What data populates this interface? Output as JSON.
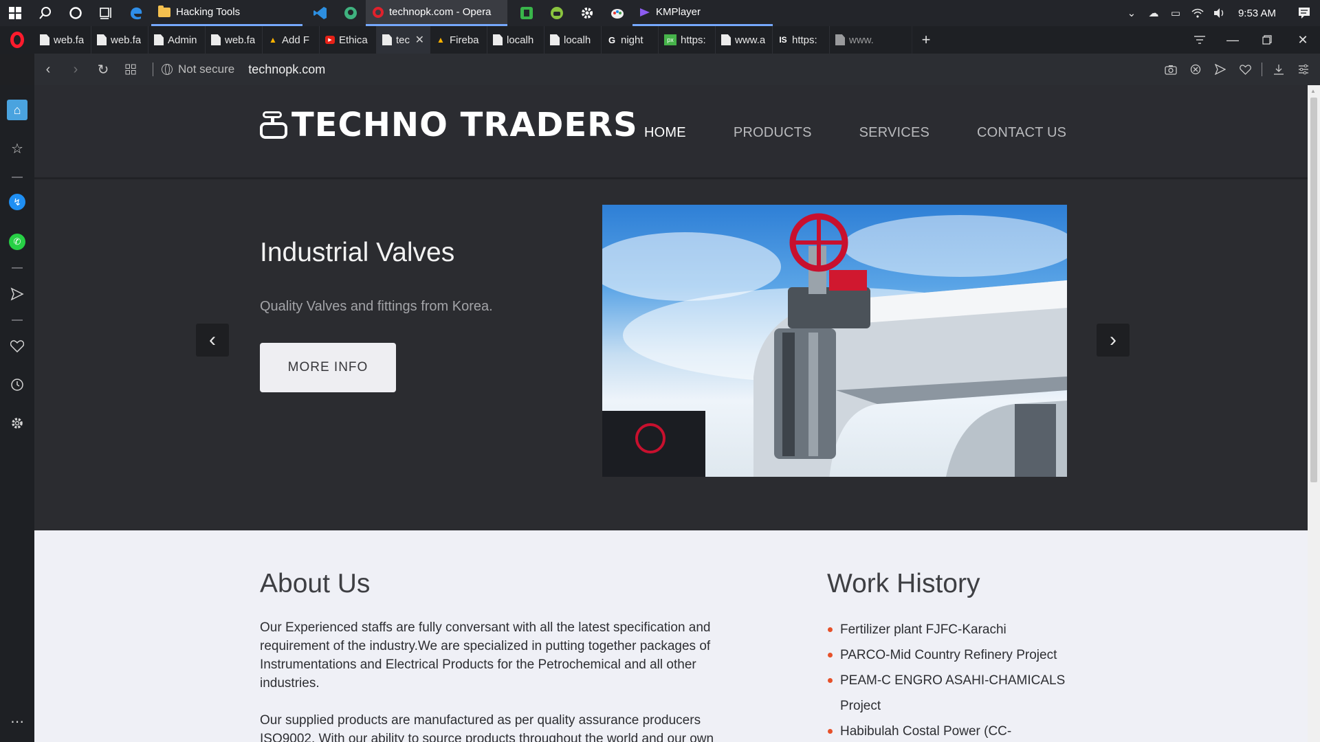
{
  "taskbar": {
    "apps": [
      {
        "label": "Hacking Tools",
        "icon": "folder-icon"
      },
      {
        "label": "technopk.com - Opera",
        "icon": "opera-icon"
      },
      {
        "label": "KMPlayer",
        "icon": "kmplayer-icon"
      }
    ],
    "clock": "9:53 AM"
  },
  "tabs": [
    {
      "label": "web.fa",
      "icon": "page-icon"
    },
    {
      "label": "web.fa",
      "icon": "page-icon"
    },
    {
      "label": "Admin",
      "icon": "page-icon"
    },
    {
      "label": "web.fa",
      "icon": "page-icon"
    },
    {
      "label": "Add F",
      "icon": "firebase-icon"
    },
    {
      "label": "Ethica",
      "icon": "youtube-icon"
    },
    {
      "label": "tec",
      "icon": "page-icon",
      "active": true
    },
    {
      "label": "Fireba",
      "icon": "firebase-icon"
    },
    {
      "label": "localh",
      "icon": "page-icon"
    },
    {
      "label": "localh",
      "icon": "page-icon"
    },
    {
      "label": "night",
      "icon": "google-icon"
    },
    {
      "label": "https:",
      "icon": "px-icon"
    },
    {
      "label": "www.a",
      "icon": "page-icon"
    },
    {
      "label": "https:",
      "icon": "is-icon"
    },
    {
      "label": "www.",
      "icon": "page-icon"
    }
  ],
  "address": {
    "security": "Not secure",
    "url": "technopk.com"
  },
  "site": {
    "brand": "TECHNO TRADERS",
    "menu": {
      "home": "HOME",
      "products": "PRODUCTS",
      "services": "SERVICES",
      "contact": "CONTACT US"
    },
    "hero": {
      "title": "Industrial Valves",
      "subtitle": "Quality Valves and fittings from Korea.",
      "button": "MORE INFO"
    },
    "about": {
      "title": "About Us",
      "p1": "Our Experienced staffs are fully conversant with all the latest specification and requirement of the industry.We are specialized in putting together packages of Instrumentations and Electrical Products for the Petrochemical and all other industries.",
      "p2": "Our supplied products are manufactured as per quality assurance producers ISO9002. With our ability to source products throughout the world and our own"
    },
    "work": {
      "title": "Work History",
      "items": [
        "Fertilizer plant FJFC-Karachi",
        "PARCO-Mid Country Refinery Project",
        "PEAM-C ENGRO ASAHI-CHAMICALS Project",
        "Habibulah Costal Power (CC-"
      ]
    }
  },
  "colors": {
    "accent_bullet": "#e6512a",
    "header_bg": "#2b2c31",
    "content_bg": "#eff0f6",
    "opera_red": "#ff1b2d"
  }
}
